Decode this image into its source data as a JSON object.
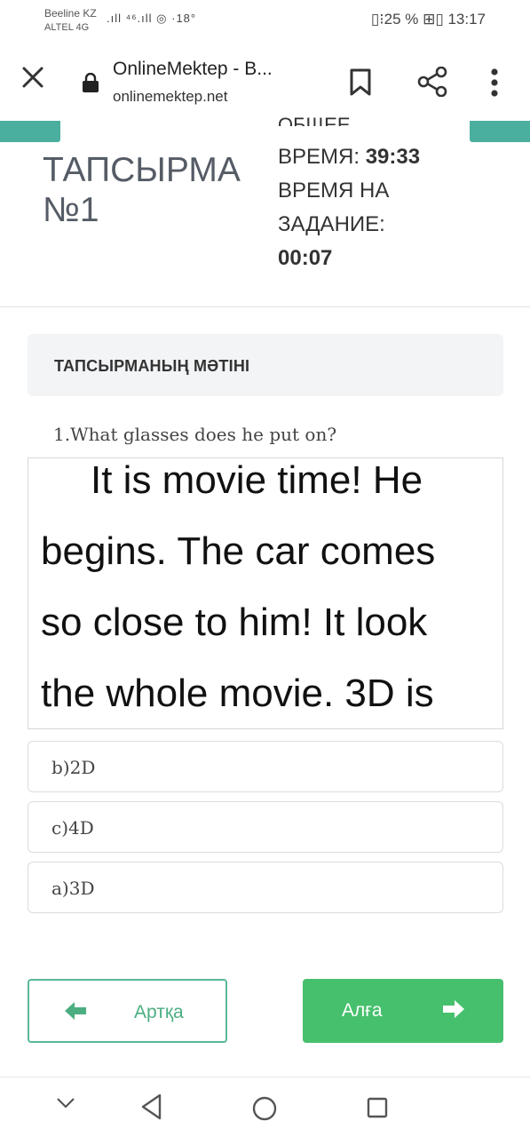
{
  "status_bar": {
    "carrier_1": "Beeline KZ",
    "carrier_2": "ALTEL 4G",
    "signal_info": ".ıll ⁴⁶.ıll ◎ ·18°",
    "battery_time": "▯⁝25 % ⊞▯ 13:17"
  },
  "browser": {
    "page_title": "OnlineMektep - В...",
    "url": "onlinemektep.net"
  },
  "quiz_header": {
    "task_title_line1": "ТАПСЫРМА",
    "task_title_line2": "№1",
    "total_time_cut": "ОБЩЕЕ",
    "total_time_label": "ВРЕМЯ:",
    "total_time_value": "39:33",
    "task_time_label": "ВРЕМЯ НА ЗАДАНИЕ:",
    "task_time_value": "00:07"
  },
  "task_panel": {
    "label": "ТАПСЫРМАНЫҢ МӘТІНІ"
  },
  "question": "1.What glasses does he put on?",
  "reading_text": {
    "line1": "It is movie time! He",
    "line2": "begins. The car comes",
    "line3": "so close to him! It look",
    "line4": "the whole movie. 3D is"
  },
  "options": [
    {
      "label": "b)2D"
    },
    {
      "label": "c)4D"
    },
    {
      "label": "a)3D"
    }
  ],
  "navigation": {
    "back_label": "Артқа",
    "next_label": "Алға"
  },
  "colors": {
    "accent_teal": "#4bafa0",
    "next_button": "#47c06d",
    "back_outline": "#58b89a"
  }
}
